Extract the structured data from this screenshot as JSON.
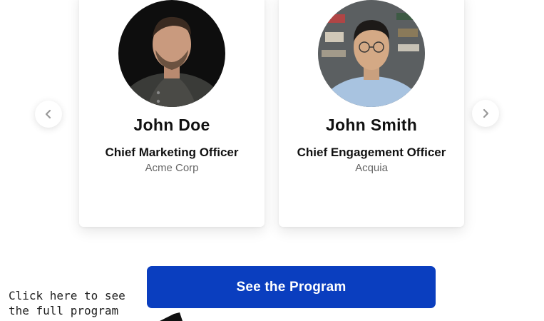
{
  "speakers": [
    {
      "name": "John Doe",
      "title": "Chief Marketing Officer",
      "company": "Acme Corp"
    },
    {
      "name": "John Smith",
      "title": "Chief Engagement Officer",
      "company": "Acquia"
    }
  ],
  "carousel": {
    "prev_icon": "chevron-left-icon",
    "next_icon": "chevron-right-icon"
  },
  "cta": {
    "label": "See the Program"
  },
  "hint": {
    "text": "Click here to see the full program"
  },
  "colors": {
    "accent": "#0a3ebf"
  }
}
